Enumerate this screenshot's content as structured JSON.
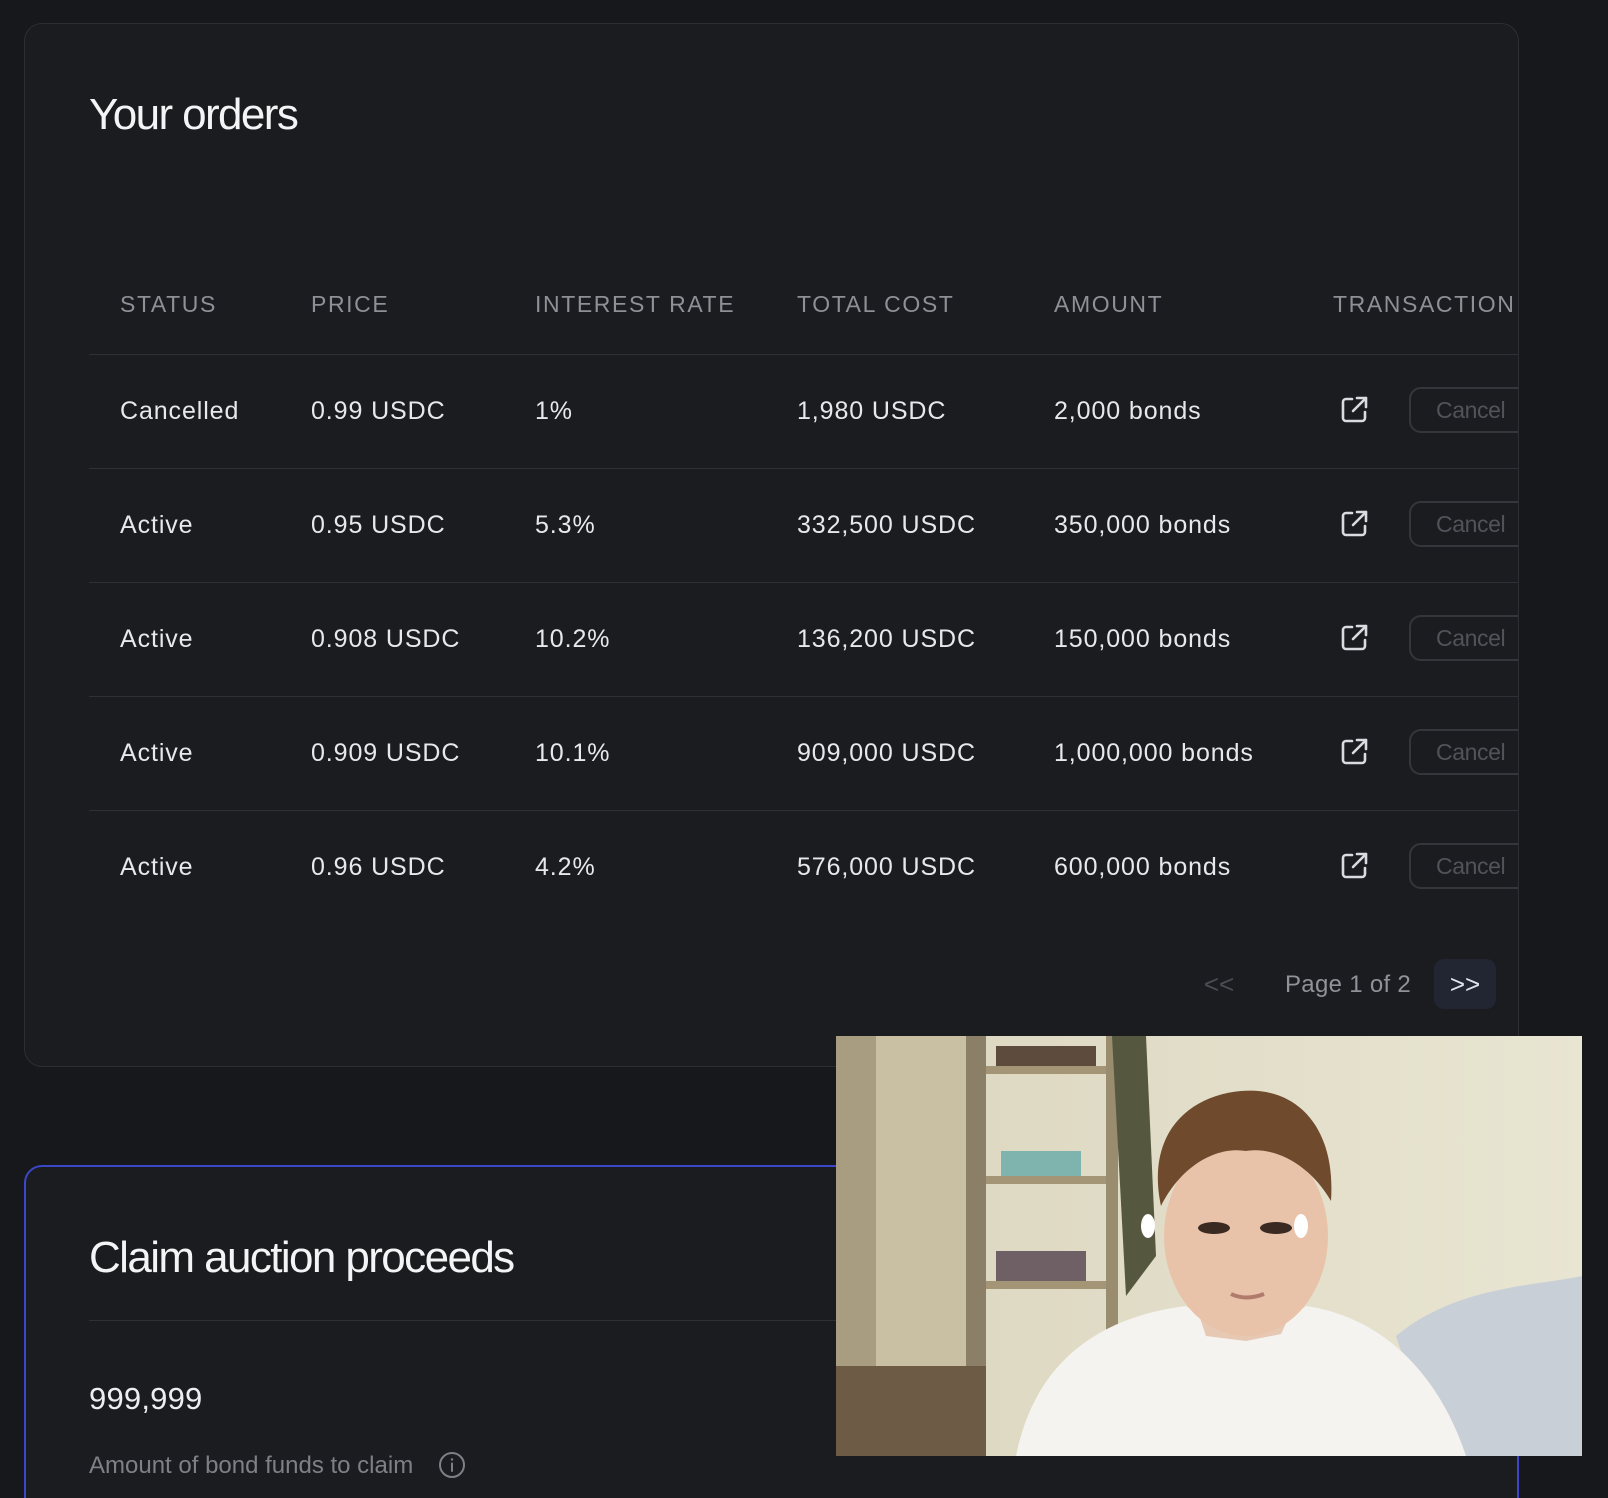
{
  "orders": {
    "title": "Your orders",
    "columns": {
      "status": "STATUS",
      "price": "PRICE",
      "interest_rate": "INTEREST RATE",
      "total_cost": "TOTAL COST",
      "amount": "AMOUNT",
      "transaction": "TRANSACTION"
    },
    "rows": [
      {
        "status": "Cancelled",
        "price": "0.99 USDC",
        "interest_rate": "1%",
        "total_cost": "1,980 USDC",
        "amount": "2,000 bonds",
        "cancel_label": "Cancel"
      },
      {
        "status": "Active",
        "price": "0.95 USDC",
        "interest_rate": "5.3%",
        "total_cost": "332,500 USDC",
        "amount": "350,000 bonds",
        "cancel_label": "Cancel"
      },
      {
        "status": "Active",
        "price": "0.908 USDC",
        "interest_rate": "10.2%",
        "total_cost": "136,200 USDC",
        "amount": "150,000 bonds",
        "cancel_label": "Cancel"
      },
      {
        "status": "Active",
        "price": "0.909 USDC",
        "interest_rate": "10.1%",
        "total_cost": "909,000 USDC",
        "amount": "1,000,000 bonds",
        "cancel_label": "Cancel"
      },
      {
        "status": "Active",
        "price": "0.96 USDC",
        "interest_rate": "4.2%",
        "total_cost": "576,000 USDC",
        "amount": "600,000 bonds",
        "cancel_label": "Cancel"
      }
    ],
    "pagination": {
      "prev_label": "<<",
      "text": "Page 1 of 2",
      "next_label": ">>"
    }
  },
  "claim": {
    "title": "Claim auction proceeds",
    "value": "999,999",
    "label": "Amount of bond funds to claim"
  },
  "icons": {
    "row_link": "external-link-icon",
    "claim_info": "info-icon"
  },
  "colors": {
    "background": "#17181b",
    "card": "#1b1c1f",
    "claim_border": "#3c46c9",
    "pager_next_bg": "#222633"
  }
}
